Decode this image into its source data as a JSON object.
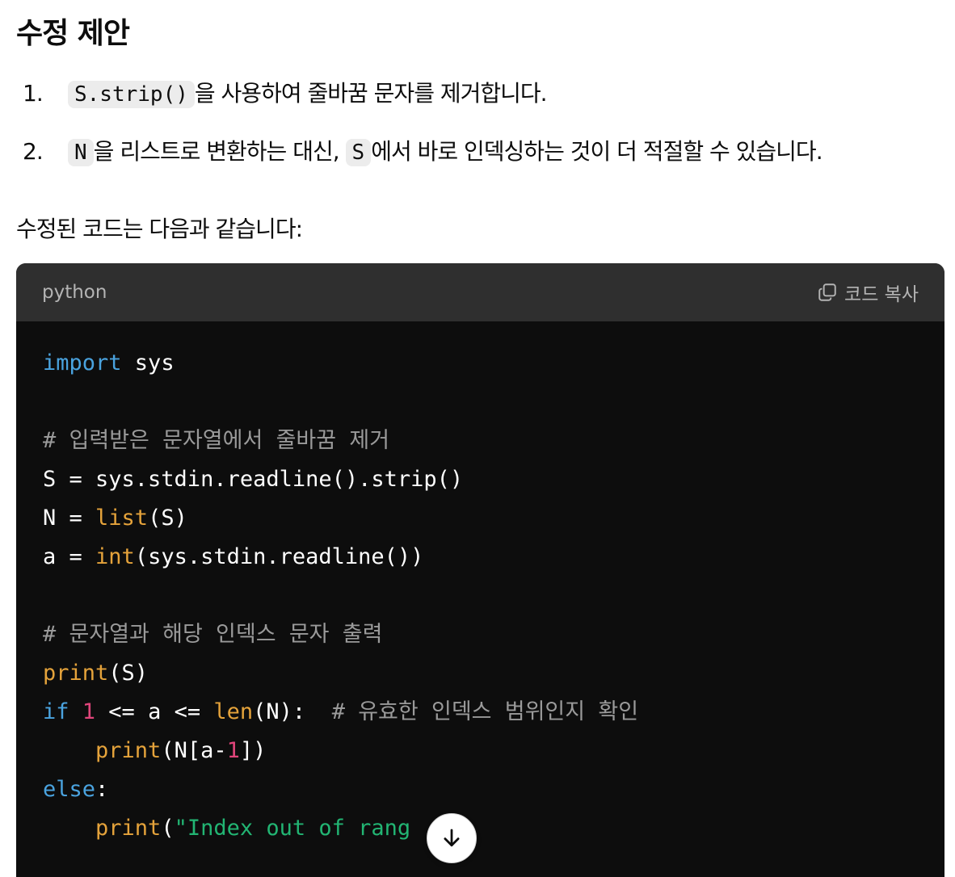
{
  "heading": "수정 제안",
  "items": [
    {
      "number": "1.",
      "code1": "S.strip()",
      "text1": "을 사용하여 줄바꿈 문자를 제거합니다."
    },
    {
      "number": "2.",
      "code1": "N",
      "text1": "을 리스트로 변환하는 대신, ",
      "code2": "S",
      "text2": "에서 바로 인덱싱하는 것이 더 적절할 수 있습니다."
    }
  ],
  "paragraph": "수정된 코드는 다음과 같습니다:",
  "code_block": {
    "language": "python",
    "copy_label": "코드 복사",
    "lines": [
      {
        "t": "import",
        "c": "kw"
      },
      {
        "t": " sys"
      },
      {
        "nl": 1
      },
      {
        "nl": 1
      },
      {
        "t": "# 입력받은 문자열에서 줄바꿈 제거",
        "c": "cm"
      },
      {
        "nl": 1
      },
      {
        "t": "S = sys.stdin.readline().strip()"
      },
      {
        "nl": 1
      },
      {
        "t": "N = "
      },
      {
        "t": "list",
        "c": "bi"
      },
      {
        "t": "(S)"
      },
      {
        "nl": 1
      },
      {
        "t": "a = "
      },
      {
        "t": "int",
        "c": "bi"
      },
      {
        "t": "(sys.stdin.readline())"
      },
      {
        "nl": 1
      },
      {
        "nl": 1
      },
      {
        "t": "# 문자열과 해당 인덱스 문자 출력",
        "c": "cm"
      },
      {
        "nl": 1
      },
      {
        "t": "print",
        "c": "bi"
      },
      {
        "t": "(S)"
      },
      {
        "nl": 1
      },
      {
        "t": "if",
        "c": "kw"
      },
      {
        "t": " "
      },
      {
        "t": "1",
        "c": "nm"
      },
      {
        "t": " <= a <= "
      },
      {
        "t": "len",
        "c": "bi"
      },
      {
        "t": "(N):  "
      },
      {
        "t": "# 유효한 인덱스 범위인지 확인",
        "c": "cm"
      },
      {
        "nl": 1
      },
      {
        "t": "    "
      },
      {
        "t": "print",
        "c": "bi"
      },
      {
        "t": "(N[a-"
      },
      {
        "t": "1",
        "c": "nm"
      },
      {
        "t": "])"
      },
      {
        "nl": 1
      },
      {
        "t": "else",
        "c": "kw"
      },
      {
        "t": ":"
      },
      {
        "nl": 1
      },
      {
        "t": "    "
      },
      {
        "t": "print",
        "c": "bi"
      },
      {
        "t": "("
      },
      {
        "t": "\"Index out of rang",
        "c": "st"
      }
    ]
  }
}
